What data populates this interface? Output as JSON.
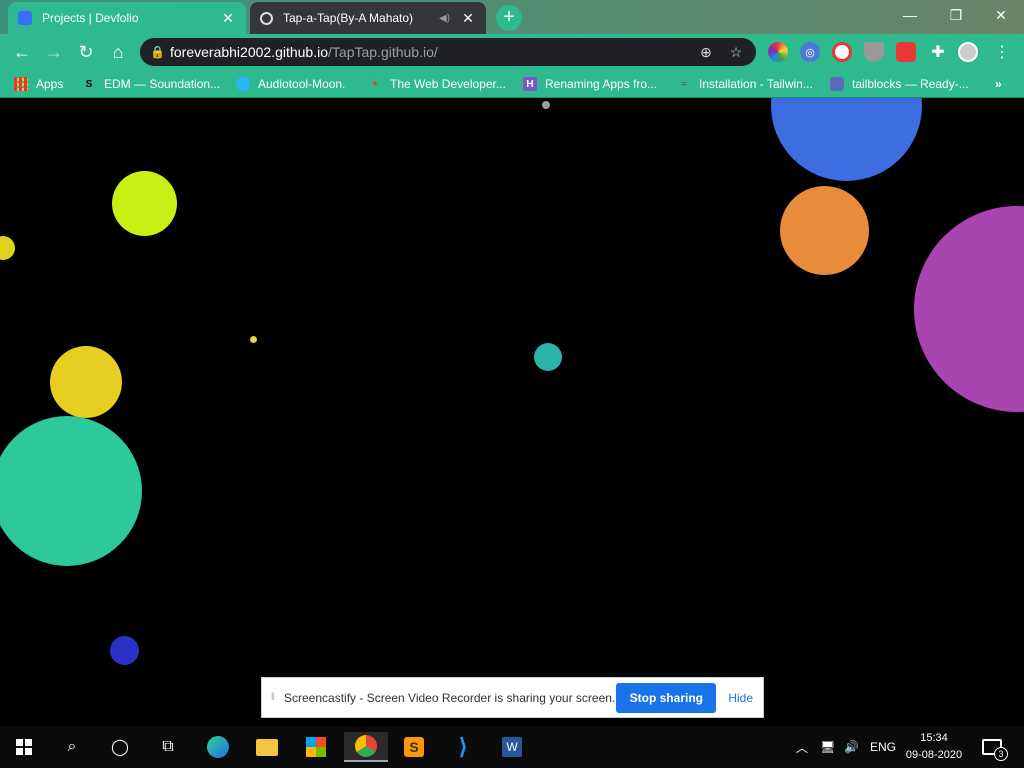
{
  "browser": {
    "tabs": [
      {
        "title": "Projects | Devfolio",
        "active": false
      },
      {
        "title": "Tap-a-Tap(By-A Mahato)",
        "active": true
      }
    ],
    "new_tab_label": "+",
    "url_host": "foreverabhi2002.github.io",
    "url_path": "/TapTap.github.io/",
    "bookmarks": [
      {
        "label": "Apps",
        "icon": "apps-grid-icon"
      },
      {
        "label": "EDM — Soundation...",
        "icon": "soundation-icon"
      },
      {
        "label": "Audiotool-Moon.",
        "icon": "audiotool-icon"
      },
      {
        "label": "The Web Developer...",
        "icon": "web-dev-icon"
      },
      {
        "label": "Renaming Apps fro...",
        "icon": "h-icon"
      },
      {
        "label": "Installation - Tailwin...",
        "icon": "tailwind-icon"
      },
      {
        "label": "tailblocks — Ready-...",
        "icon": "tailblocks-icon"
      }
    ],
    "bookmarks_overflow": "»"
  },
  "page": {
    "balls": [
      {
        "color": "#c8f014",
        "name": "lime-ball"
      },
      {
        "color": "#e1d21e",
        "name": "yellow-ball-small-left"
      },
      {
        "color": "#e6cf20",
        "name": "yellow-ball"
      },
      {
        "color": "#2ec99a",
        "name": "green-ball-large"
      },
      {
        "color": "#2a32c6",
        "name": "navy-ball"
      },
      {
        "color": "#2bb3a8",
        "name": "teal-ball"
      },
      {
        "color": "#e3d34a",
        "name": "tiny-yellow-dot"
      },
      {
        "color": "#9aa0a6",
        "name": "tiny-gray-dot"
      },
      {
        "color": "#3d6de0",
        "name": "blue-ball"
      },
      {
        "color": "#e88c3c",
        "name": "orange-ball"
      },
      {
        "color": "#a945b0",
        "name": "purple-ball"
      }
    ]
  },
  "screencastify": {
    "message": "Screencastify - Screen Video Recorder is sharing your screen.",
    "stop_label": "Stop sharing",
    "hide_label": "Hide"
  },
  "taskbar": {
    "language": "ENG",
    "time": "15:34",
    "date": "09-08-2020",
    "notification_count": "3"
  }
}
